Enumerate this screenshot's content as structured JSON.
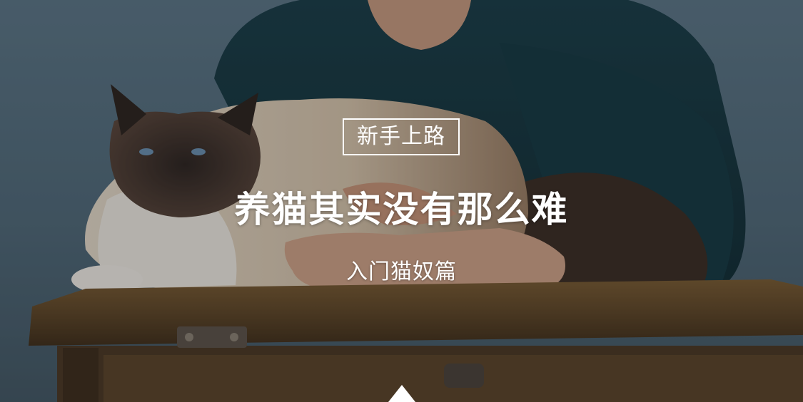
{
  "hero": {
    "badge_text": "新手上路",
    "headline": "养猫其实没有那么难",
    "subheadline": "入门猫奴篇",
    "scroll_indicator_icon": "triangle-up-icon"
  },
  "colors": {
    "text": "#ffffff",
    "wall": "#567080",
    "sweater": "#14353e",
    "desk": "#6a4e2a"
  }
}
